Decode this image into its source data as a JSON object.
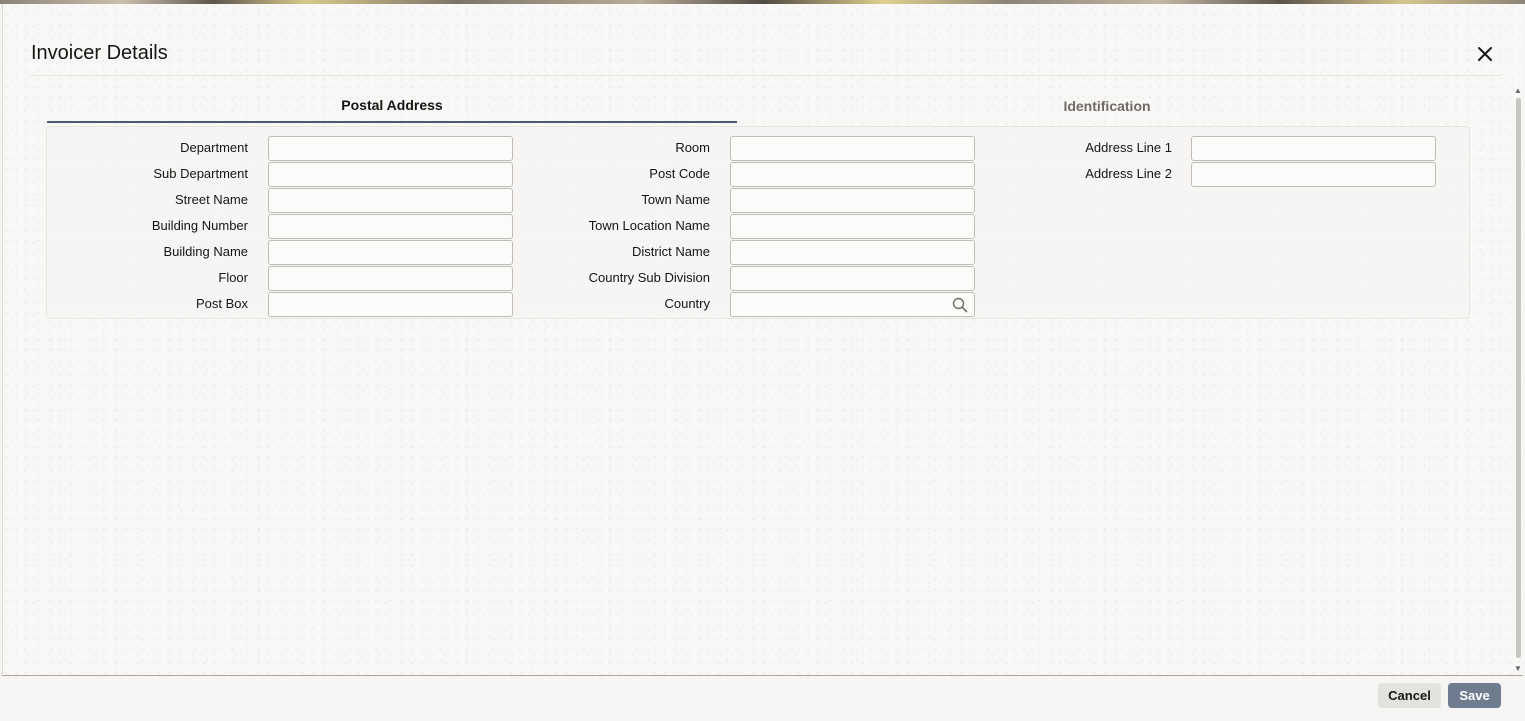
{
  "dialog": {
    "title": "Invoicer Details",
    "close_icon": "close-icon"
  },
  "tabs": [
    {
      "label": "Postal Address",
      "active": true
    },
    {
      "label": "Identification",
      "active": false
    }
  ],
  "form": {
    "col1": [
      {
        "label": "Department",
        "value": ""
      },
      {
        "label": "Sub Department",
        "value": ""
      },
      {
        "label": "Street Name",
        "value": ""
      },
      {
        "label": "Building Number",
        "value": ""
      },
      {
        "label": "Building Name",
        "value": ""
      },
      {
        "label": "Floor",
        "value": ""
      },
      {
        "label": "Post Box",
        "value": ""
      }
    ],
    "col2": [
      {
        "label": "Room",
        "value": ""
      },
      {
        "label": "Post Code",
        "value": ""
      },
      {
        "label": "Town Name",
        "value": ""
      },
      {
        "label": "Town Location Name",
        "value": ""
      },
      {
        "label": "District Name",
        "value": ""
      },
      {
        "label": "Country Sub Division",
        "value": ""
      },
      {
        "label": "Country",
        "value": "",
        "icon": "search-icon"
      }
    ],
    "col3": [
      {
        "label": "Address Line 1",
        "value": ""
      },
      {
        "label": "Address Line 2",
        "value": ""
      }
    ]
  },
  "footer": {
    "cancel_label": "Cancel",
    "save_label": "Save"
  },
  "colors": {
    "accent": "#4c5a72",
    "save_button": "#6f7b8e",
    "cancel_button": "#e4e2de"
  }
}
